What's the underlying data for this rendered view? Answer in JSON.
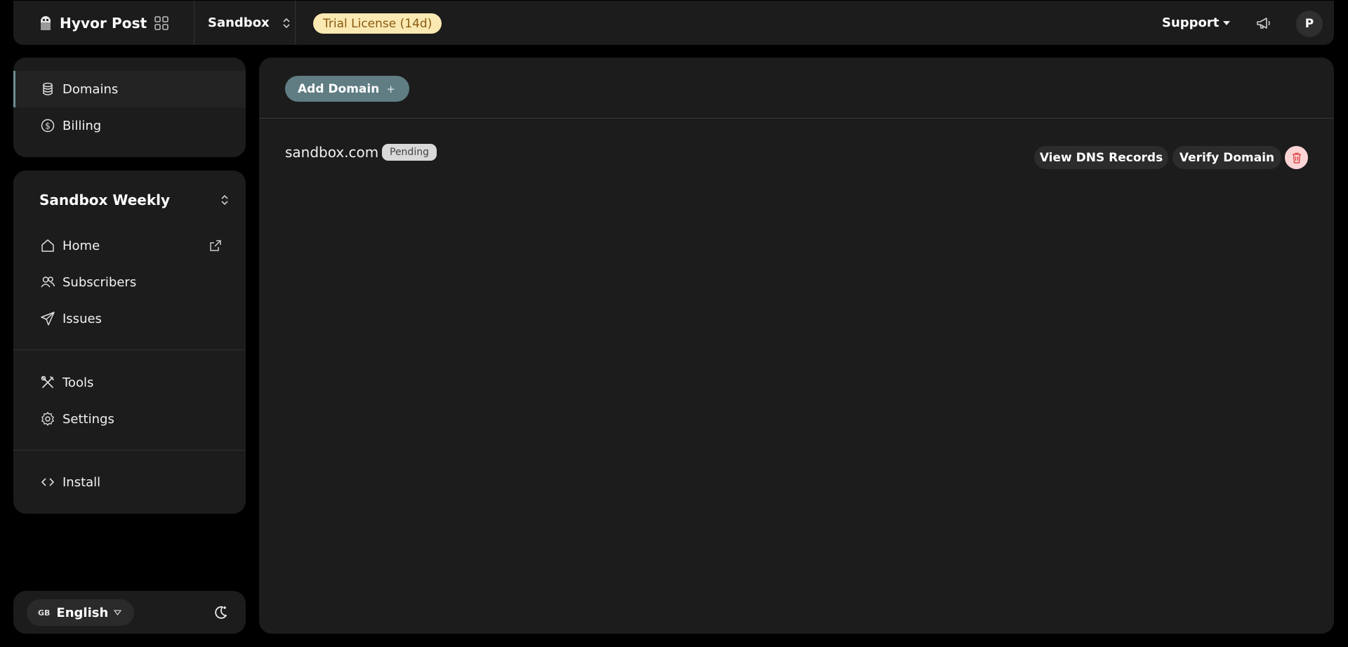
{
  "header": {
    "app_name": "Hyvor Post",
    "project_name": "Sandbox",
    "trial_badge": "Trial License (14d)",
    "support_label": "Support",
    "avatar_initial": "P"
  },
  "sidebar": {
    "primary_items": [
      {
        "label": "Domains",
        "icon": "database-icon",
        "active": true
      },
      {
        "label": "Billing",
        "icon": "dollar-circle-icon",
        "active": false
      }
    ],
    "newsletter_name": "Sandbox Weekly",
    "newsletter_items": [
      {
        "label": "Home",
        "icon": "home-icon"
      },
      {
        "label": "Subscribers",
        "icon": "people-icon"
      },
      {
        "label": "Issues",
        "icon": "send-icon"
      }
    ],
    "settings_items": [
      {
        "label": "Tools",
        "icon": "tools-icon"
      },
      {
        "label": "Settings",
        "icon": "gear-icon"
      }
    ],
    "install_item": {
      "label": "Install",
      "icon": "code-icon"
    }
  },
  "footer": {
    "flag_code": "GB",
    "language": "English"
  },
  "main": {
    "add_domain_label": "Add Domain",
    "domains": [
      {
        "name": "sandbox.com",
        "status": "Pending",
        "view_dns_label": "View DNS Records",
        "verify_label": "Verify Domain"
      }
    ]
  },
  "colors": {
    "accent": "#5f7d83",
    "trial_badge_bg": "#fae9b2",
    "trial_badge_text": "#8a5a12",
    "delete_bg": "#fbd5d5",
    "delete_icon": "#e04848",
    "panel_bg": "#1c1c1c",
    "page_bg": "#000000"
  }
}
